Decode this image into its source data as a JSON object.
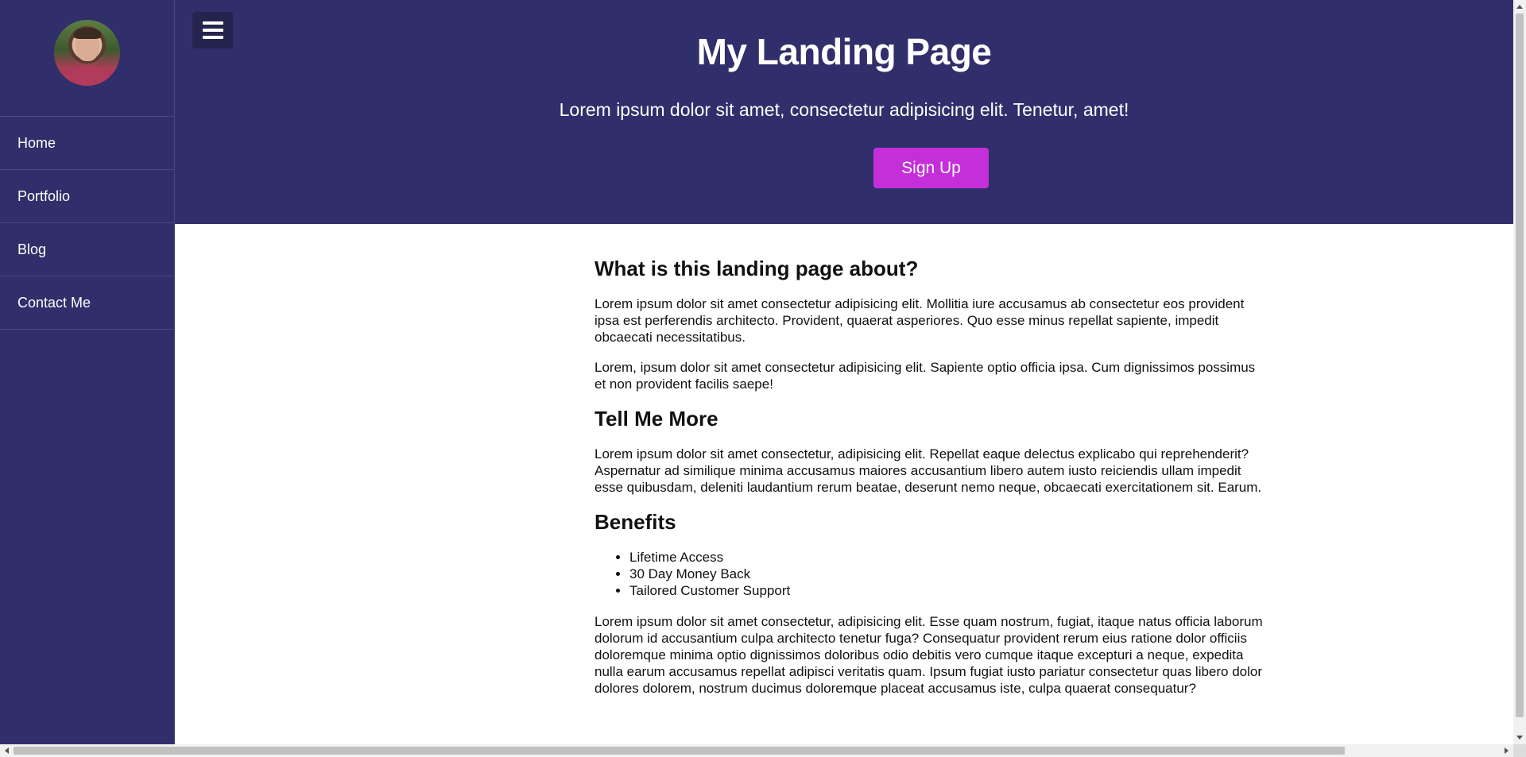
{
  "sidebar": {
    "nav": [
      {
        "label": "Home"
      },
      {
        "label": "Portfolio"
      },
      {
        "label": "Blog"
      },
      {
        "label": "Contact Me"
      }
    ]
  },
  "header": {
    "title": "My Landing Page",
    "subtitle": "Lorem ipsum dolor sit amet, consectetur adipisicing elit. Tenetur, amet!",
    "signup_label": "Sign Up"
  },
  "content": {
    "section1": {
      "heading": "What is this landing page about?",
      "p1": "Lorem ipsum dolor sit amet consectetur adipisicing elit. Mollitia iure accusamus ab consectetur eos provident ipsa est perferendis architecto. Provident, quaerat asperiores. Quo esse minus repellat sapiente, impedit obcaecati necessitatibus.",
      "p2": "Lorem, ipsum dolor sit amet consectetur adipisicing elit. Sapiente optio officia ipsa. Cum dignissimos possimus et non provident facilis saepe!"
    },
    "section2": {
      "heading": "Tell Me More",
      "p1": "Lorem ipsum dolor sit amet consectetur, adipisicing elit. Repellat eaque delectus explicabo qui reprehenderit? Aspernatur ad similique minima accusamus maiores accusantium libero autem iusto reiciendis ullam impedit esse quibusdam, deleniti laudantium rerum beatae, deserunt nemo neque, obcaecati exercitationem sit. Earum."
    },
    "section3": {
      "heading": "Benefits",
      "benefits": [
        "Lifetime Access",
        "30 Day Money Back",
        "Tailored Customer Support"
      ],
      "p1": "Lorem ipsum dolor sit amet consectetur, adipisicing elit. Esse quam nostrum, fugiat, itaque natus officia laborum dolorum id accusantium culpa architecto tenetur fuga? Consequatur provident rerum eius ratione dolor officiis doloremque minima optio dignissimos doloribus odio debitis vero cumque itaque excepturi a neque, expedita nulla earum accusamus repellat adipisci veritatis quam. Ipsum fugiat iusto pariatur consectetur quas libero dolor dolores dolorem, nostrum ducimus doloremque placeat accusamus iste, culpa quaerat consequatur?"
    }
  },
  "colors": {
    "sidebar_bg": "#302f6b",
    "header_bg": "#302f6b",
    "menu_button_bg": "#25244f",
    "accent": "#c42fd9"
  },
  "icons": {
    "menu": "hamburger-menu-icon",
    "profile": "profile-avatar"
  }
}
